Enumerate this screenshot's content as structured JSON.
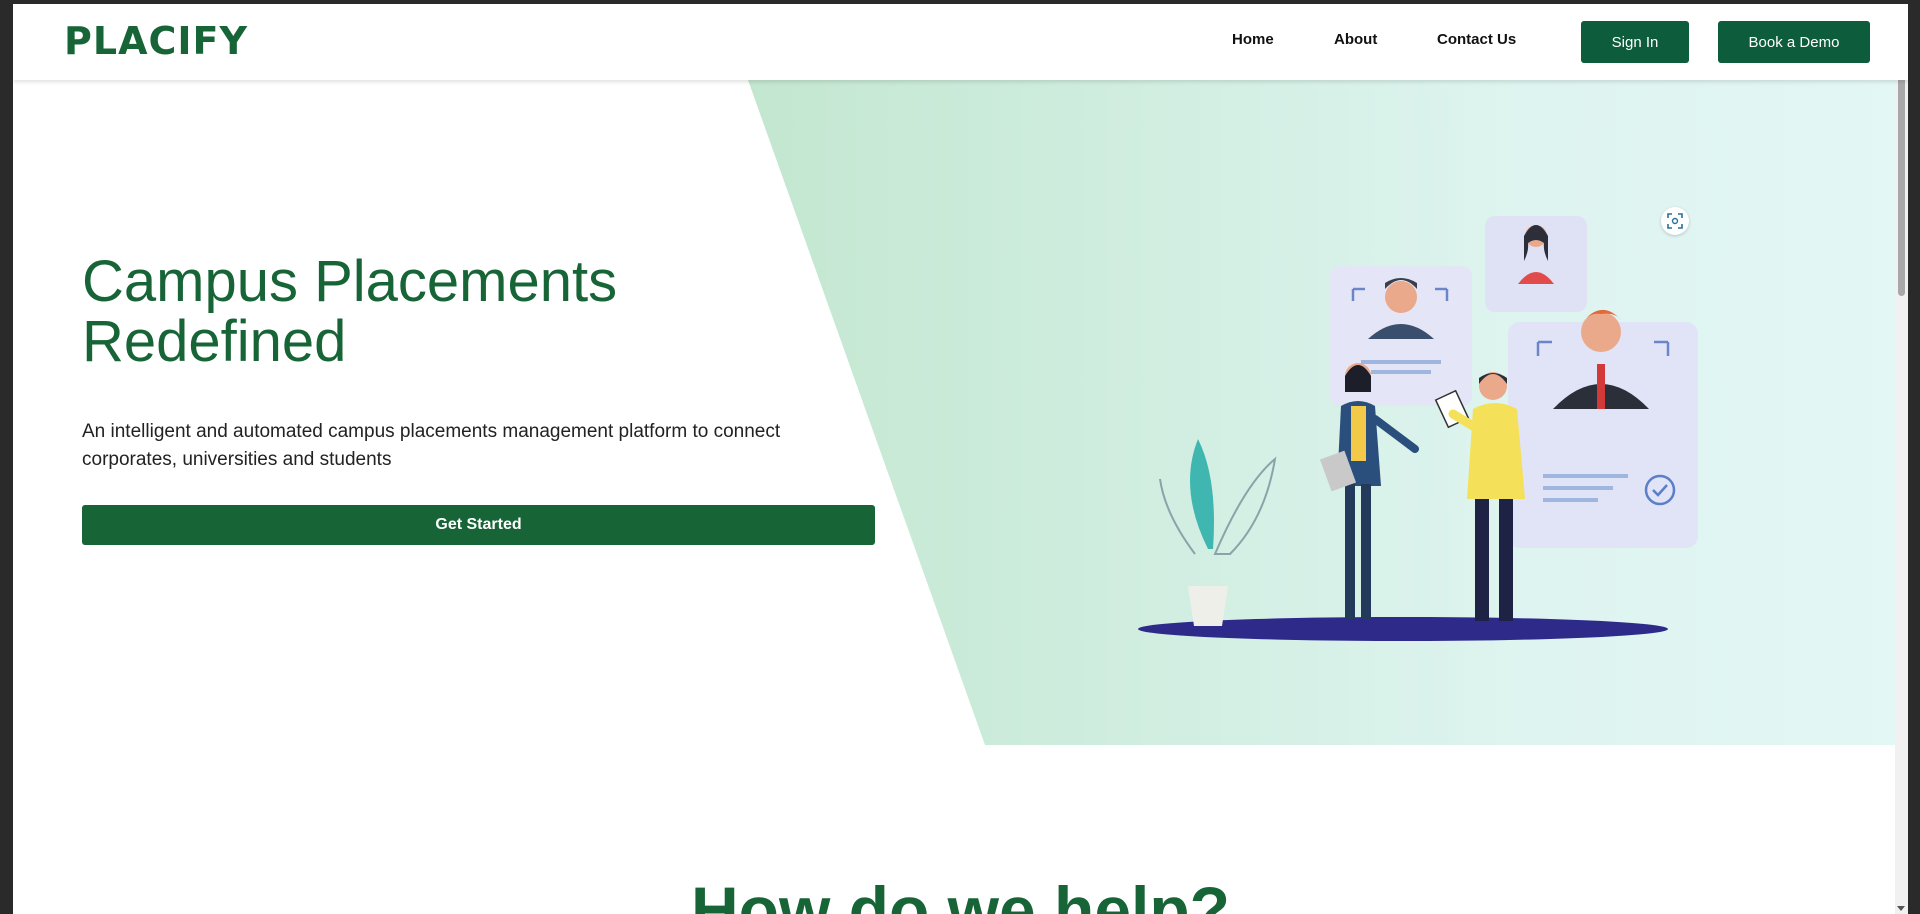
{
  "header": {
    "logo_text": "PLACIFY",
    "nav": [
      {
        "label": "Home"
      },
      {
        "label": "About"
      },
      {
        "label": "Contact Us"
      }
    ],
    "sign_in_label": "Sign In",
    "book_demo_label": "Book a Demo"
  },
  "hero": {
    "title": "Campus Placements\nRedefined",
    "description": "An intelligent and automated campus placements management platform to connect corporates, universities and students",
    "cta_label": "Get Started",
    "illustration_icon": "recruitment-illustration",
    "scan_icon": "scan-icon"
  },
  "next_section": {
    "heading": "How do we help?"
  },
  "colors": {
    "brand": "#176437",
    "button_dark": "#0d5c3c",
    "hero_gradient_start": "#a9d6b2",
    "hero_gradient_end": "#e3f7f5"
  }
}
